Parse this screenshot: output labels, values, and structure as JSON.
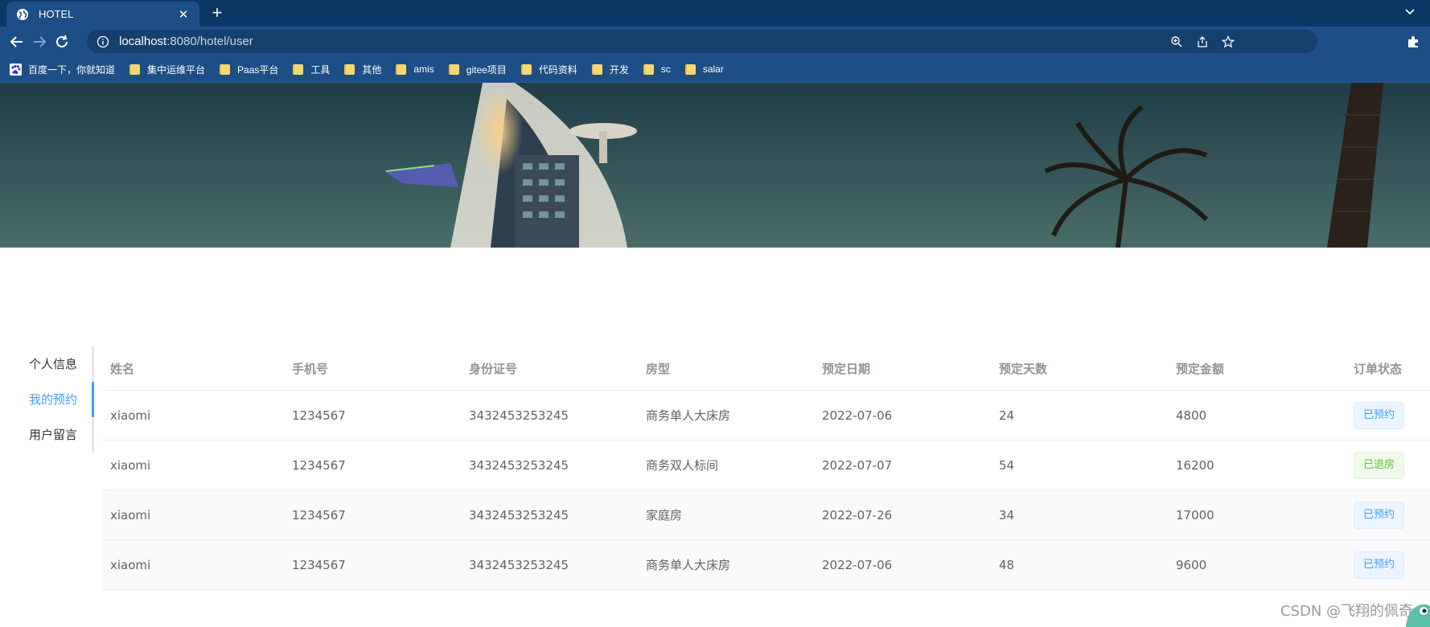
{
  "browser": {
    "tab_title": "HOTEL",
    "url_host": "localhost",
    "url_path": ":8080/hotel/user",
    "bookmarks": [
      {
        "label": "百度一下，你就知道",
        "icon": "baidu-icon"
      },
      {
        "label": "集中运维平台",
        "icon": "folder-icon"
      },
      {
        "label": "Paas平台",
        "icon": "folder-icon"
      },
      {
        "label": "工具",
        "icon": "folder-icon"
      },
      {
        "label": "其他",
        "icon": "folder-icon"
      },
      {
        "label": "amis",
        "icon": "folder-icon"
      },
      {
        "label": "gitee项目",
        "icon": "folder-icon"
      },
      {
        "label": "代码资料",
        "icon": "folder-icon"
      },
      {
        "label": "开发",
        "icon": "folder-icon"
      },
      {
        "label": "sc",
        "icon": "folder-icon"
      },
      {
        "label": "salar",
        "icon": "folder-icon"
      }
    ]
  },
  "sidebar": {
    "items": [
      {
        "label": "个人信息",
        "active": false
      },
      {
        "label": "我的预约",
        "active": true
      },
      {
        "label": "用户留言",
        "active": false
      }
    ]
  },
  "table": {
    "columns": [
      "姓名",
      "手机号",
      "身份证号",
      "房型",
      "预定日期",
      "预定天数",
      "预定金额",
      "订单状态"
    ],
    "rows": [
      {
        "name": "xiaomi",
        "phone": "1234567",
        "id_card": "3432453253245",
        "room": "商务单人大床房",
        "date": "2022-07-06",
        "days": "24",
        "amount": "4800",
        "status": "已预约",
        "status_type": "primary"
      },
      {
        "name": "xiaomi",
        "phone": "1234567",
        "id_card": "3432453253245",
        "room": "商务双人标间",
        "date": "2022-07-07",
        "days": "54",
        "amount": "16200",
        "status": "已退房",
        "status_type": "success"
      },
      {
        "name": "xiaomi",
        "phone": "1234567",
        "id_card": "3432453253245",
        "room": "家庭房",
        "date": "2022-07-26",
        "days": "34",
        "amount": "17000",
        "status": "已预约",
        "status_type": "primary"
      },
      {
        "name": "xiaomi",
        "phone": "1234567",
        "id_card": "3432453253245",
        "room": "商务单人大床房",
        "date": "2022-07-06",
        "days": "48",
        "amount": "9600",
        "status": "已预约",
        "status_type": "primary"
      }
    ]
  },
  "watermark": "CSDN @飞翔的佩奇",
  "colors": {
    "accent": "#409eff",
    "success": "#67c23a",
    "chrome": "#1d4f86"
  }
}
